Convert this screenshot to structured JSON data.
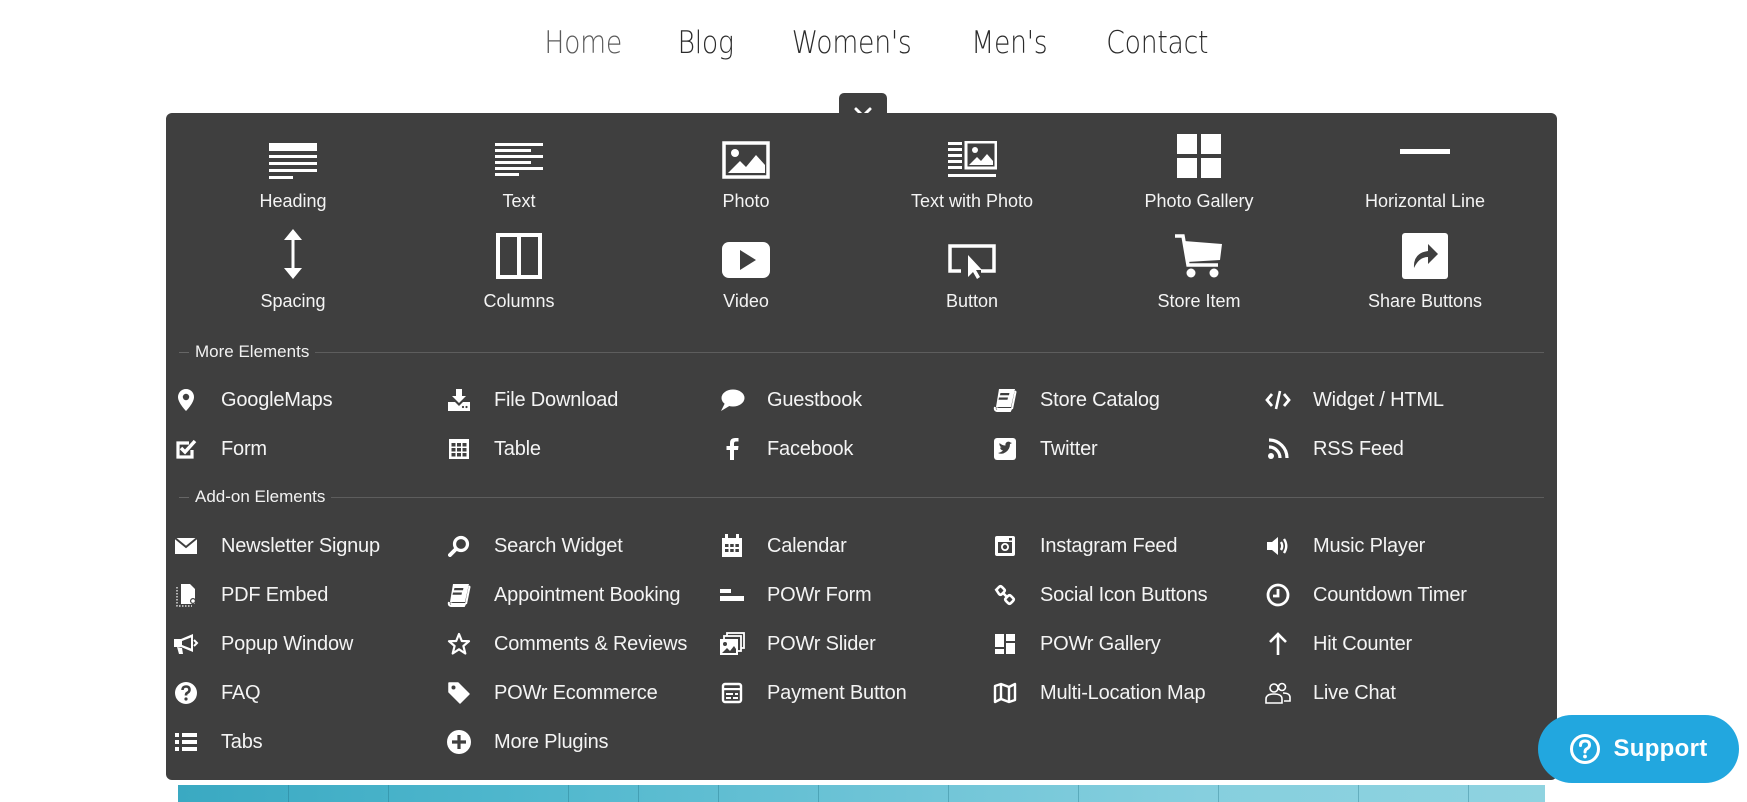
{
  "nav": {
    "items": [
      {
        "label": "Home",
        "active": true
      },
      {
        "label": "Blog"
      },
      {
        "label": "Women's"
      },
      {
        "label": "Men's"
      },
      {
        "label": "Contact"
      }
    ]
  },
  "panel": {
    "close_icon": "close-icon",
    "basic_elements": [
      {
        "label": "Heading",
        "icon": "heading-icon"
      },
      {
        "label": "Text",
        "icon": "text-icon"
      },
      {
        "label": "Photo",
        "icon": "photo-icon"
      },
      {
        "label": "Text with Photo",
        "icon": "text-with-photo-icon"
      },
      {
        "label": "Photo Gallery",
        "icon": "photo-gallery-icon"
      },
      {
        "label": "Horizontal Line",
        "icon": "horizontal-line-icon"
      },
      {
        "label": "Spacing",
        "icon": "spacing-icon"
      },
      {
        "label": "Columns",
        "icon": "columns-icon"
      },
      {
        "label": "Video",
        "icon": "video-icon"
      },
      {
        "label": "Button",
        "icon": "button-icon"
      },
      {
        "label": "Store Item",
        "icon": "cart-icon"
      },
      {
        "label": "Share Buttons",
        "icon": "share-icon"
      }
    ],
    "more_elements": {
      "title": "More Elements",
      "items": [
        {
          "label": "GoogleMaps",
          "icon": "map-pin-icon"
        },
        {
          "label": "File Download",
          "icon": "download-icon"
        },
        {
          "label": "Guestbook",
          "icon": "speech-bubble-icon"
        },
        {
          "label": "Store Catalog",
          "icon": "book-icon"
        },
        {
          "label": "Widget / HTML",
          "icon": "code-icon"
        },
        {
          "label": "Form",
          "icon": "checkbox-icon"
        },
        {
          "label": "Table",
          "icon": "table-icon"
        },
        {
          "label": "Facebook",
          "icon": "facebook-icon"
        },
        {
          "label": "Twitter",
          "icon": "twitter-icon"
        },
        {
          "label": "RSS Feed",
          "icon": "rss-icon"
        }
      ]
    },
    "addon_elements": {
      "title": "Add-on Elements",
      "items": [
        {
          "label": "Newsletter Signup",
          "icon": "envelope-icon"
        },
        {
          "label": "Search Widget",
          "icon": "search-icon"
        },
        {
          "label": "Calendar",
          "icon": "calendar-icon"
        },
        {
          "label": "Instagram Feed",
          "icon": "instagram-icon"
        },
        {
          "label": "Music Player",
          "icon": "speaker-icon"
        },
        {
          "label": "PDF Embed",
          "icon": "pdf-icon"
        },
        {
          "label": "Appointment Booking",
          "icon": "book-icon"
        },
        {
          "label": "POWr Form",
          "icon": "form-bars-icon"
        },
        {
          "label": "Social Icon Buttons",
          "icon": "link-icon"
        },
        {
          "label": "Countdown Timer",
          "icon": "clock-icon"
        },
        {
          "label": "Popup Window",
          "icon": "megaphone-icon"
        },
        {
          "label": "Comments & Reviews",
          "icon": "star-icon"
        },
        {
          "label": "POWr Slider",
          "icon": "slider-images-icon"
        },
        {
          "label": "POWr Gallery",
          "icon": "gallery-grid-icon"
        },
        {
          "label": "Hit Counter",
          "icon": "arrow-up-icon"
        },
        {
          "label": "FAQ",
          "icon": "question-circle-icon"
        },
        {
          "label": "POWr Ecommerce",
          "icon": "tag-icon"
        },
        {
          "label": "Payment Button",
          "icon": "receipt-icon"
        },
        {
          "label": "Multi-Location Map",
          "icon": "folded-map-icon"
        },
        {
          "label": "Live Chat",
          "icon": "users-icon"
        },
        {
          "label": "Tabs",
          "icon": "list-icon"
        },
        {
          "label": "More Plugins",
          "icon": "plus-circle-icon"
        }
      ]
    }
  },
  "support": {
    "label": "Support",
    "icon": "question-circle-icon",
    "color": "#22a7df"
  },
  "colors": {
    "panel_bg": "#3f3f3f",
    "nav_text": "#2b2b2b",
    "nav_active": "#5a5a5a"
  }
}
